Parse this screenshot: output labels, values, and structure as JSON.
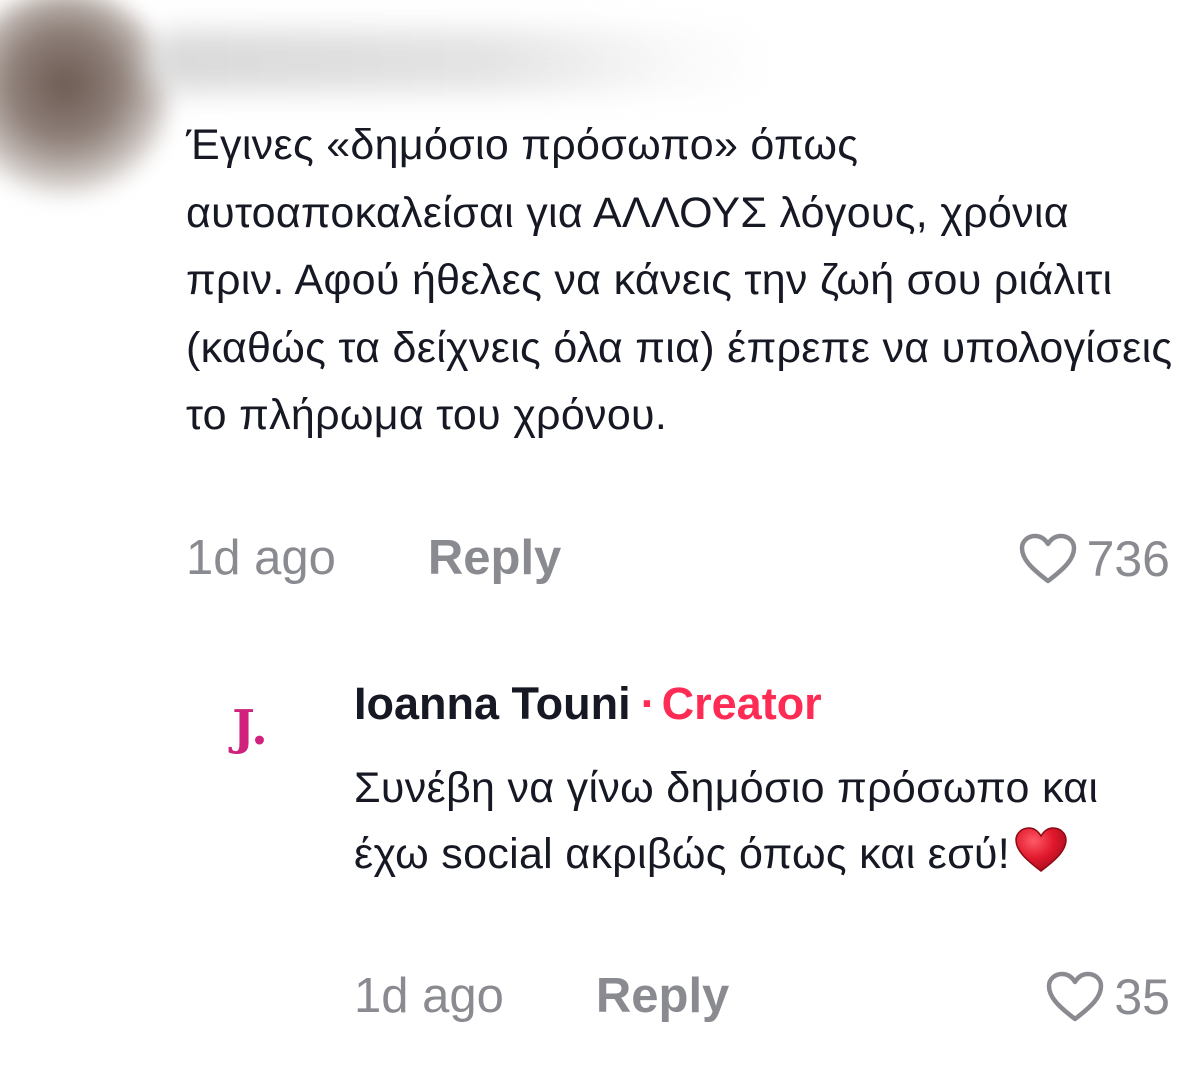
{
  "comment": {
    "text": "Έγινες «δημόσιο πρόσωπο» όπως αυτοαποκαλείσαι για ΑΛΛΟΥΣ λόγους, χρόνια πριν. Αφού ήθελες να κάνεις την ζωή σου ριάλιτι (καθώς τα δείχνεις όλα πια) έπρεπε να υπολογίσεις το πλήρωμα του χρόνου.",
    "time": "1d ago",
    "reply_label": "Reply",
    "likes": "736"
  },
  "reply": {
    "avatar_letter": "J.",
    "author": "Ioanna Touni",
    "separator": "·",
    "badge": "Creator",
    "text": "Συνέβη να γίνω δημόσιο πρόσωπο και έχω social ακριβώς όπως και εσύ!",
    "emoji": "red-heart",
    "time": "1d ago",
    "reply_label": "Reply",
    "likes": "35"
  },
  "colors": {
    "text": "#161823",
    "muted": "#8a8b91",
    "creator_accent": "#fe2c55",
    "avatar_letter": "#d0217d",
    "heart_emoji": "#e0182d"
  }
}
